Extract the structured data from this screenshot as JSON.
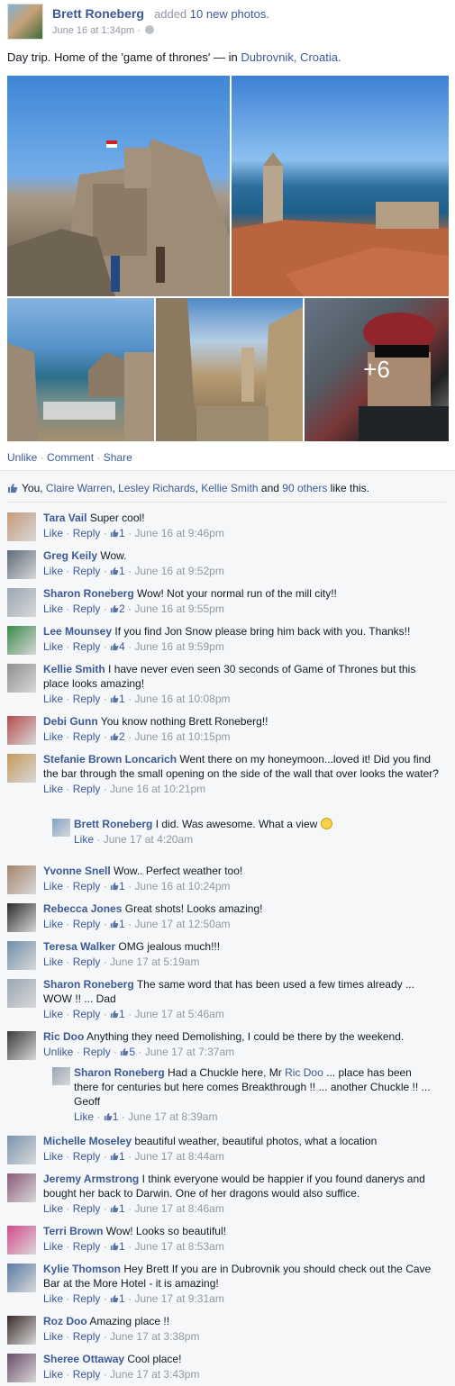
{
  "post": {
    "author": "Brett Roneberg",
    "action_pre": "added",
    "action_link": "10 new photos.",
    "timestamp": "June 16 at 1:34pm · ",
    "message_text": "Day trip. Home of the 'game of thrones' — in ",
    "location": "Dubrovnik, Croatia.",
    "more_photos_label": "+6",
    "actions": {
      "unlike": "Unlike",
      "comment": "Comment",
      "share": "Share",
      "sep": " · "
    }
  },
  "likes": {
    "you": "You, ",
    "n1": "Claire Warren",
    "n2": "Lesley Richards",
    "n3": "Kellie Smith",
    "and": " and ",
    "others": "90 others",
    "suffix": " like this.",
    "c1": ", ",
    "c2": ", "
  },
  "comments": [
    {
      "name": "Tara Vail",
      "text": "Super cool!",
      "likes": "1",
      "time": "June 16 at 9:46pm",
      "like_label": "Like",
      "reply_label": "Reply",
      "color": "#c59a7b"
    },
    {
      "name": "Greg Keily",
      "text": "Wow.",
      "likes": "1",
      "time": "June 16 at 9:52pm",
      "like_label": "Like",
      "reply_label": "Reply",
      "color": "#5d6b7a"
    },
    {
      "name": "Sharon Roneberg",
      "text": "Wow! Not your normal run of the mill city!!",
      "likes": "2",
      "time": "June 16 at 9:55pm",
      "like_label": "Like",
      "reply_label": "Reply",
      "color": "#9aa7b5"
    },
    {
      "name": "Lee Mounsey",
      "text": "If you find Jon Snow please bring him back with you. Thanks!!",
      "likes": "4",
      "time": "June 16 at 9:59pm",
      "like_label": "Like",
      "reply_label": "Reply",
      "color": "#3b8a4a"
    },
    {
      "name": "Kellie Smith",
      "text": "I have never even seen 30 seconds of Game of Thrones but this place looks amazing!",
      "likes": "1",
      "time": "June 16 at 10:08pm",
      "like_label": "Like",
      "reply_label": "Reply",
      "color": "#8f8f8f"
    },
    {
      "name": "Debi Gunn",
      "text": "You know nothing Brett Roneberg!!",
      "likes": "2",
      "time": "June 16 at 10:15pm",
      "like_label": "Like",
      "reply_label": "Reply",
      "color": "#b44d4d"
    },
    {
      "name": "Stefanie Brown Loncarich",
      "text": "Went there on my honeymoon...loved it! Did you find the bar through the small opening on the side of the wall that over looks the water?",
      "likes": "",
      "time": "June 16 at 10:21pm",
      "like_label": "Like",
      "reply_label": "Reply",
      "color": "#c49a5b"
    },
    {
      "name": "Brett Roneberg",
      "text": "I did. Was awesome. What a view",
      "likes": "",
      "time": "June 17 at 4:20am",
      "like_label": "Like",
      "reply_label": "",
      "color": "#7fa3c4"
    },
    {
      "name": "Yvonne Snell",
      "text": "Wow.. Perfect weather too!",
      "likes": "1",
      "time": "June 16 at 10:24pm",
      "like_label": "Like",
      "reply_label": "Reply",
      "color": "#a4856e"
    },
    {
      "name": "Rebecca Jones",
      "text": "Great shots! Looks amazing!",
      "likes": "1",
      "time": "June 17 at 12:50am",
      "like_label": "Like",
      "reply_label": "Reply",
      "color": "#2b2b2b"
    },
    {
      "name": "Teresa Walker",
      "text": "OMG jealous much!!!",
      "likes": "",
      "time": "June 17 at 5:19am",
      "like_label": "Like",
      "reply_label": "Reply",
      "color": "#6f8ea8"
    },
    {
      "name": "Sharon Roneberg",
      "text": "The same word that has been used a few times already ... WOW !! ... Dad",
      "likes": "1",
      "time": "June 17 at 5:46am",
      "like_label": "Like",
      "reply_label": "Reply",
      "color": "#9aa7b5"
    },
    {
      "name": "Ric Doo",
      "text": "Anything they need Demolishing, I could be there by the weekend.",
      "likes": "5",
      "time": "June 17 at 7:37am",
      "like_label": "Unlike",
      "reply_label": "Reply",
      "color": "#3a3a3a"
    },
    {
      "name": "Sharon Roneberg",
      "text_pre": "Had a Chuckle here, Mr ",
      "text_link": "Ric Doo",
      "text_post": " ... place has been there for centuries but here comes Breakthrough !! ... another Chuckle !! ... Geoff",
      "likes": "1",
      "time": "June 17 at 8:39am",
      "like_label": "Like",
      "reply_label": "",
      "color": "#9aa7b5"
    },
    {
      "name": "Michelle Moseley",
      "text": "beautiful weather, beautiful photos, what a location",
      "likes": "1",
      "time": "June 17 at 8:44am",
      "like_label": "Like",
      "reply_label": "Reply",
      "color": "#7a95b0"
    },
    {
      "name": "Jeremy Armstrong",
      "text": "I think everyone would be happier if you found danerys and bought her back to Darwin. One of her dragons would also suffice.",
      "likes": "1",
      "time": "June 17 at 8:46am",
      "like_label": "Like",
      "reply_label": "Reply",
      "color": "#8a5a7a"
    },
    {
      "name": "Terri Brown",
      "text": "Wow! Looks so beautiful!",
      "likes": "1",
      "time": "June 17 at 8:53am",
      "like_label": "Like",
      "reply_label": "Reply",
      "color": "#d64a8c"
    },
    {
      "name": "Kylie Thomson",
      "text": "Hey Brett If you are in Dubrovnik you should check out the Cave Bar at the More Hotel - it is amazing!",
      "likes": "1",
      "time": "June 17 at 9:31am",
      "like_label": "Like",
      "reply_label": "Reply",
      "color": "#5a7ca5"
    },
    {
      "name": "Roz Doo",
      "text": "Amazing place !!",
      "likes": "",
      "time": "June 17 at 3:38pm",
      "like_label": "Like",
      "reply_label": "Reply",
      "color": "#3a2a2a"
    },
    {
      "name": "Sheree Ottaway",
      "text": "Cool place!",
      "likes": "",
      "time": "June 17 at 3:43pm",
      "like_label": "Like",
      "reply_label": "Reply",
      "color": "#6a4a6a"
    }
  ]
}
